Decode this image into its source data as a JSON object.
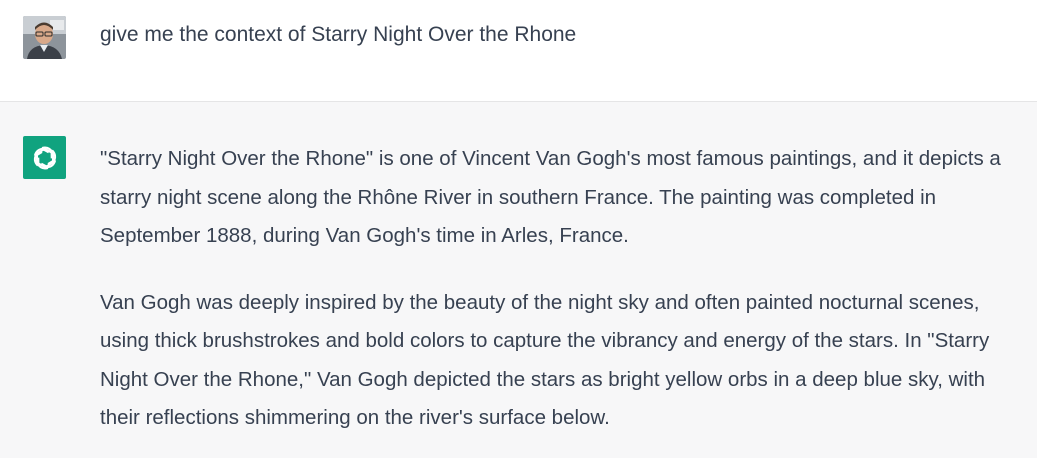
{
  "user_message": {
    "avatar": "user-photo-avatar",
    "text": "give me the context of Starry Night Over the Rhone"
  },
  "assistant_message": {
    "avatar": "openai-logo-icon",
    "brand_color": "#10a37f",
    "paragraphs": [
      "\"Starry Night Over the Rhone\" is one of Vincent Van Gogh's most famous paintings, and it depicts a starry night scene along the Rhône River in southern France. The painting was completed in September 1888, during Van Gogh's time in Arles, France.",
      "Van Gogh was deeply inspired by the beauty of the night sky and often painted nocturnal scenes, using thick brushstrokes and bold colors to capture the vibrancy and energy of the stars. In \"Starry Night Over the Rhone,\" Van Gogh depicted the stars as bright yellow orbs in a deep blue sky, with their reflections shimmering on the river's surface below."
    ]
  }
}
